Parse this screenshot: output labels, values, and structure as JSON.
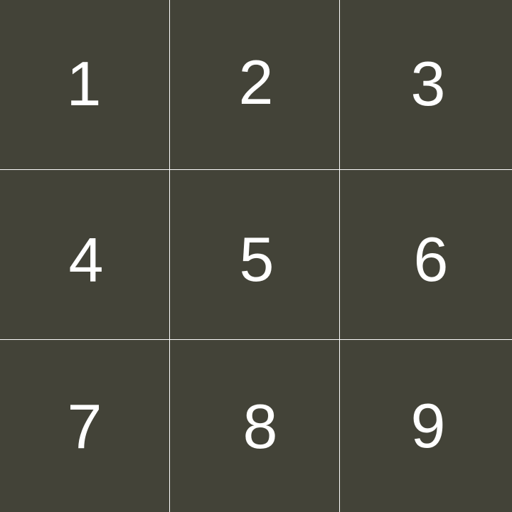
{
  "colors": {
    "tile_background": "#434338",
    "grid_lines": "#ffffff",
    "label_text": "#ffffff"
  },
  "tiles": [
    {
      "label": "1"
    },
    {
      "label": "2"
    },
    {
      "label": "3"
    },
    {
      "label": "4"
    },
    {
      "label": "5"
    },
    {
      "label": "6"
    },
    {
      "label": "7"
    },
    {
      "label": "8"
    },
    {
      "label": "9"
    }
  ]
}
